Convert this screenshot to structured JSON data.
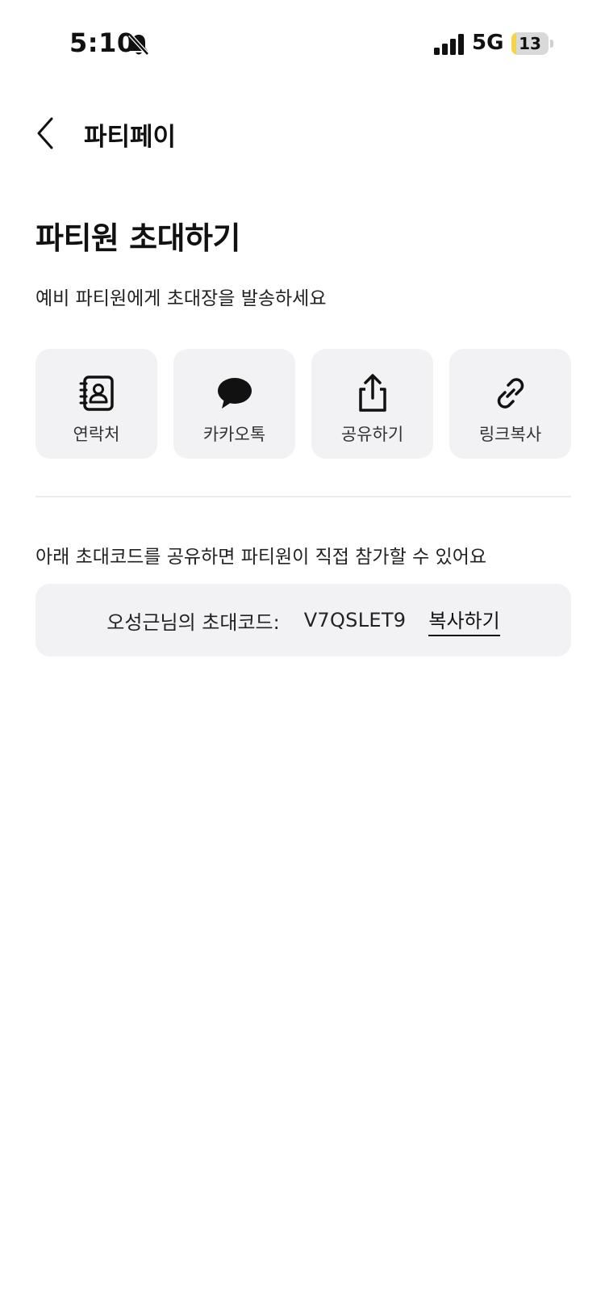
{
  "status_bar": {
    "time": "5:10",
    "network": "5G",
    "battery_level": "13",
    "battery_fraction": 0.13
  },
  "nav": {
    "title": "파티페이"
  },
  "page": {
    "title": "파티원 초대하기",
    "subtitle": "예비 파티원에게 초대장을 발송하세요"
  },
  "share_options": [
    {
      "label": "연락처",
      "icon": "contacts-icon"
    },
    {
      "label": "카카오톡",
      "icon": "chat-bubble-icon"
    },
    {
      "label": "공유하기",
      "icon": "share-icon"
    },
    {
      "label": "링크복사",
      "icon": "link-icon"
    }
  ],
  "invite_code": {
    "hint": "아래 초대코드를 공유하면 파티원이 직접 참가할 수 있어요",
    "label": "오성근님의 초대코드:",
    "code": "V7QSLET9",
    "copy_label": "복사하기"
  }
}
